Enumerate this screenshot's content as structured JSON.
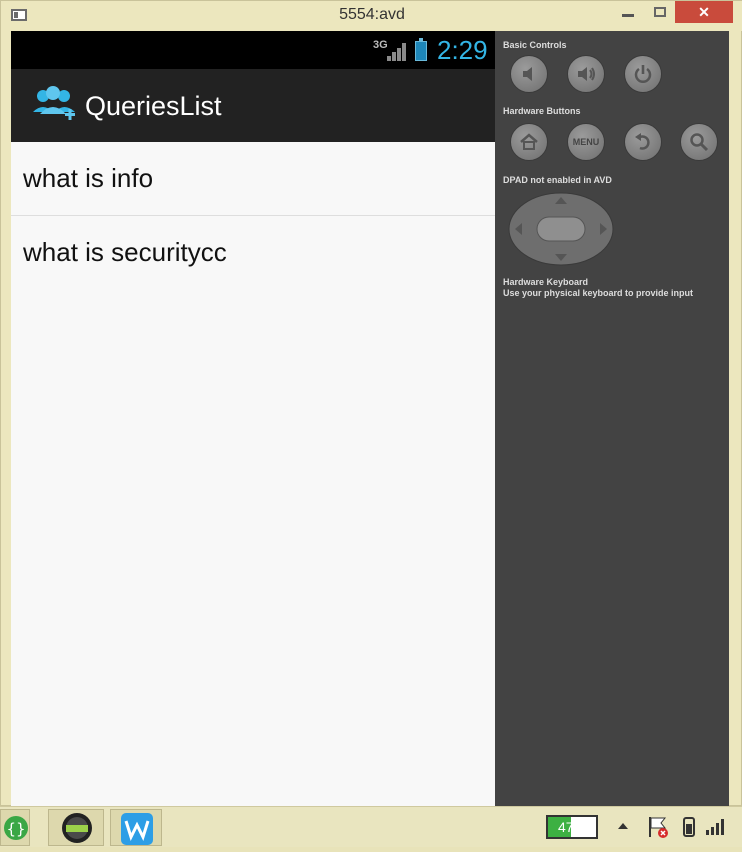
{
  "window": {
    "title": "5554:avd"
  },
  "device": {
    "network_type": "3G",
    "time": "2:29",
    "app_title": "QueriesList",
    "list_items": [
      "what is info",
      "what is securitycc"
    ]
  },
  "controls": {
    "basic_controls_label": "Basic Controls",
    "hardware_buttons_label": "Hardware Buttons",
    "menu_label": "MENU",
    "dpad_label": "DPAD not enabled in AVD",
    "keyboard_label": "Hardware Keyboard",
    "keyboard_hint": "Use your physical keyboard to provide input"
  },
  "taskbar": {
    "battery_percent": "47%",
    "battery_level": 0.47
  },
  "icons": [
    "window-icon",
    "minimize-icon",
    "maximize-icon",
    "close-icon",
    "signal-icon",
    "battery-icon",
    "queries-users-icon",
    "volume-down-icon",
    "volume-up-icon",
    "power-icon",
    "home-icon",
    "back-icon",
    "search-icon",
    "dpad-icon",
    "app-brackets-icon",
    "and-app-icon",
    "w-app-icon",
    "tray-arrow-icon",
    "flag-icon",
    "phone-icon",
    "signal-bars-icon"
  ],
  "colors": {
    "accent": "#33b5e5",
    "actionbar": "#222222",
    "panel": "#434343",
    "close": "#c94b3c",
    "battery_fill": "#3db042"
  }
}
